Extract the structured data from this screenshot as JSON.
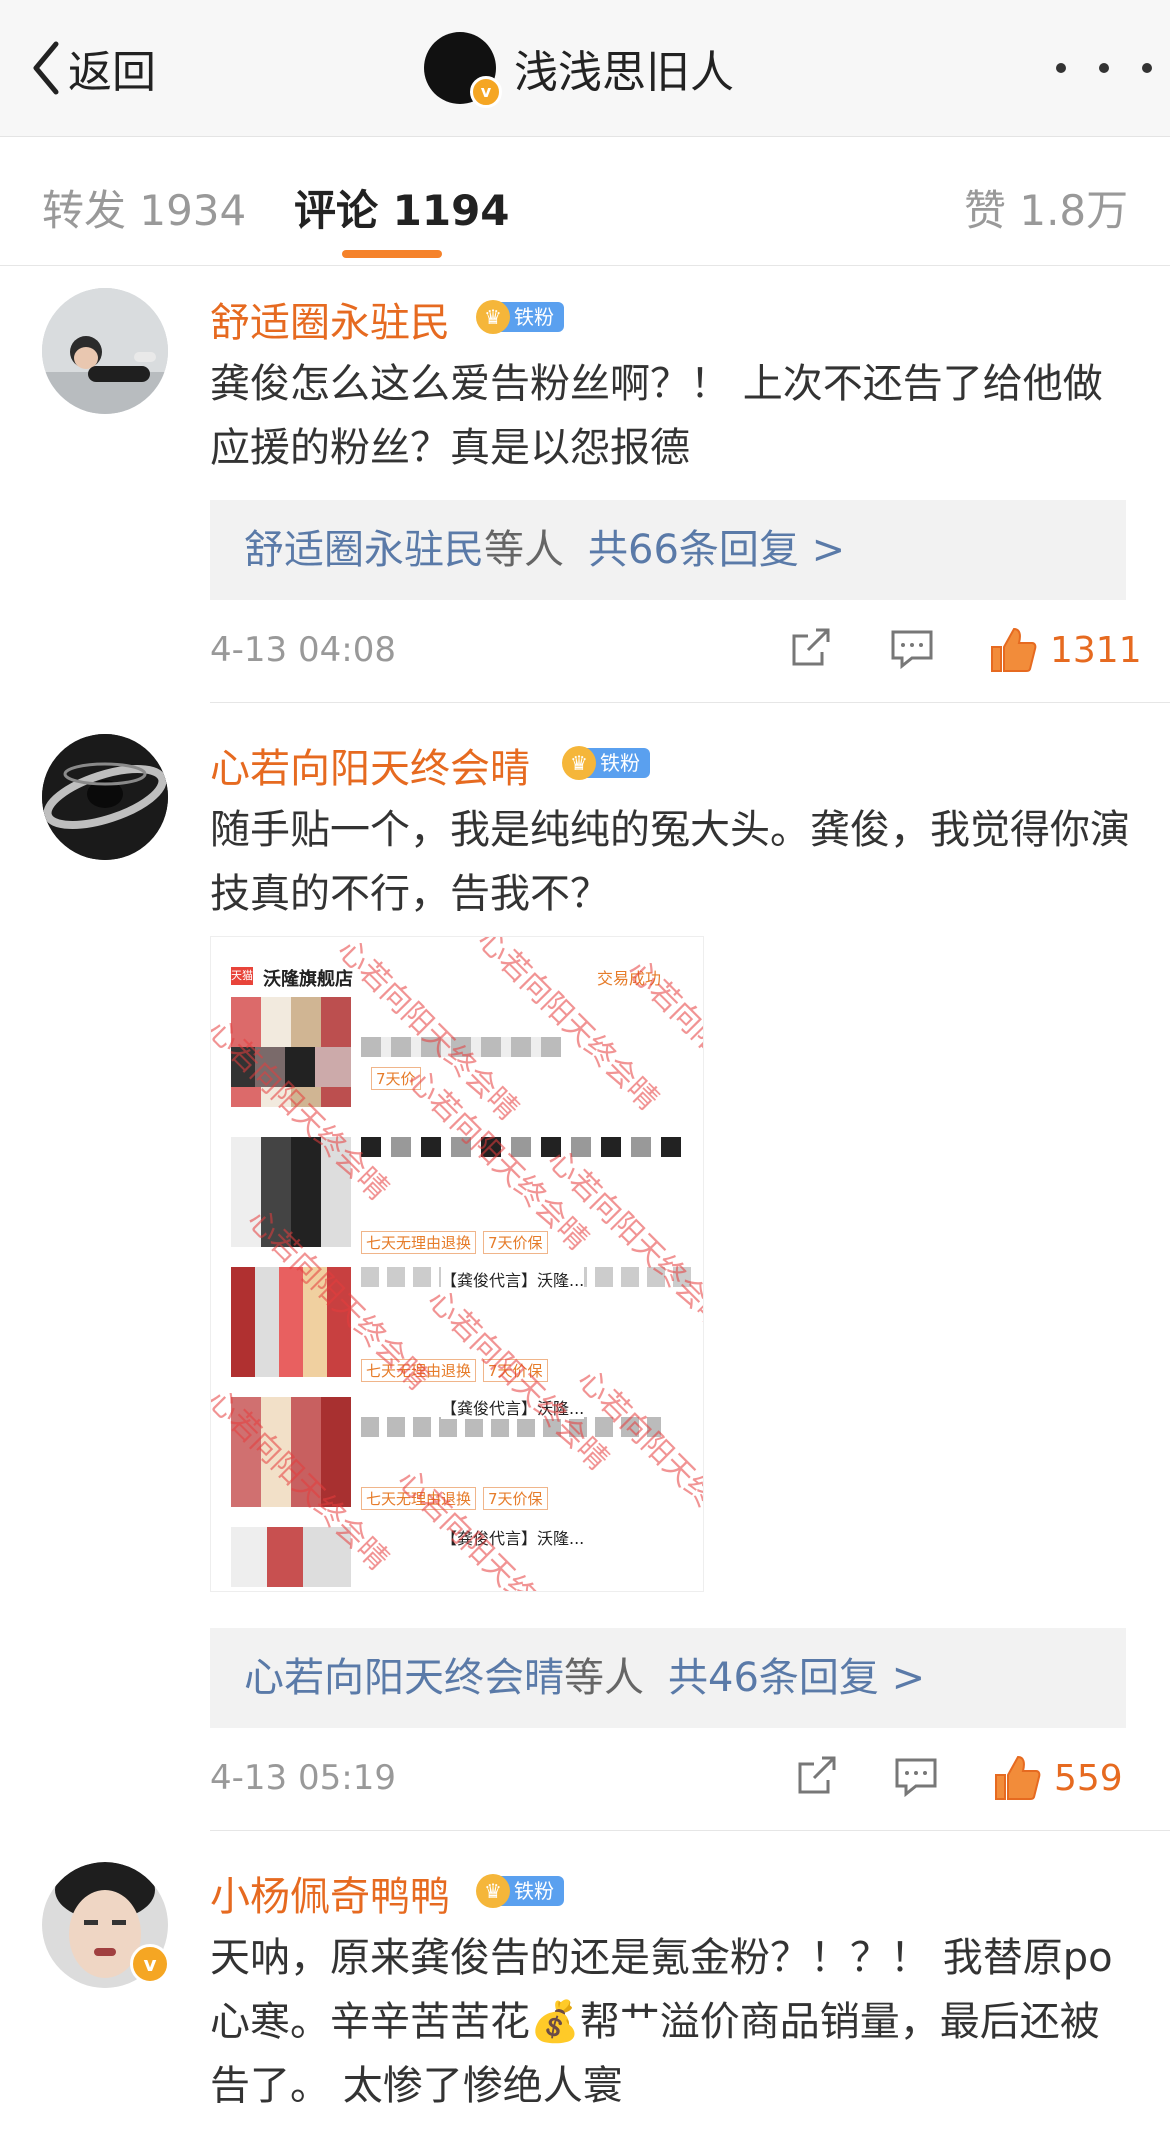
{
  "header": {
    "back_label": "返回",
    "title": "浅浅思旧人",
    "verified_mark": "v"
  },
  "tabs": {
    "repost": "转发 1934",
    "comment": "评论 1194",
    "like": "赞 1.8万"
  },
  "comments": [
    {
      "name": "舒适圈永驻民",
      "badge": "铁粉",
      "text": "龚俊怎么这么爱告粉丝啊？！ 上次不还告了给他做应援的粉丝？真是以怨报德",
      "reply_name": "舒适圈永驻民",
      "reply_mid": "等人",
      "reply_count": "共66条回复 >",
      "time": "4-13 04:08",
      "likes": "1311"
    },
    {
      "name": "心若向阳天终会晴",
      "badge": "铁粉",
      "text": "随手贴一个，我是纯纯的冤大头。龚俊，我觉得你演技真的不行，告我不？",
      "reply_name": "心若向阳天终会晴",
      "reply_mid": "等人",
      "reply_count": "共46条回复 >",
      "time": "4-13 05:19",
      "likes": "559"
    },
    {
      "name": "小杨佩奇鸭鸭",
      "badge": "铁粉",
      "verified_mark": "v",
      "text": "天呐，原来龚俊告的还是氪金粉？！？！ 我替原po心寒。辛辛苦苦花💰帮艹溢价商品销量，最后还被告了。 太惨了惨绝人寰"
    }
  ],
  "shot": {
    "store_logo": "天猫",
    "store_name": "沃隆旗舰店",
    "status": "交易成功",
    "tag_return": "七天无理由退换",
    "tag_price": "7天价保",
    "item_title": "【龚俊代言】沃隆...",
    "partial_tag": "7天价",
    "watermark": "心若向阳天终会晴"
  },
  "icon_names": [
    "chevron-left-icon",
    "more-icon",
    "share-icon",
    "comment-icon",
    "thumbs-up-icon",
    "crown-icon",
    "money-bag-icon"
  ]
}
